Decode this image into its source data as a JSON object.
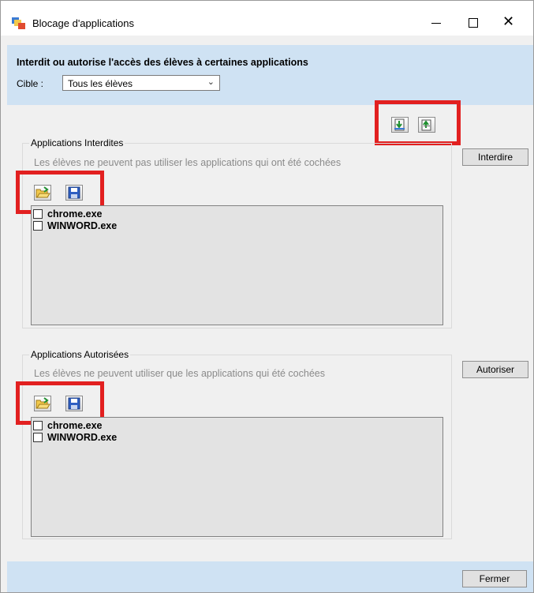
{
  "window": {
    "title": "Blocage d'applications"
  },
  "header": {
    "title": "Interdit ou autorise l'accès des élèves à certaines applications",
    "cible_label": "Cible :",
    "cible_value": "Tous les élèves"
  },
  "interdites": {
    "title": "Applications Interdites",
    "description": "Les élèves ne peuvent pas utiliser les applications qui ont été cochées",
    "items": [
      {
        "label": "chrome.exe",
        "checked": false
      },
      {
        "label": "WINWORD.exe",
        "checked": false
      }
    ],
    "button": "Interdire"
  },
  "autorisees": {
    "title": "Applications Autorisées",
    "description": "Les élèves ne peuvent utiliser que les applications qui été cochées",
    "items": [
      {
        "label": "chrome.exe",
        "checked": false
      },
      {
        "label": "WINWORD.exe",
        "checked": false
      }
    ],
    "button": "Autoriser"
  },
  "footer": {
    "close_label": "Fermer"
  },
  "colors": {
    "header_bg": "#cfe2f3",
    "highlight": "#e22020",
    "list_bg": "#e3e3e3"
  }
}
